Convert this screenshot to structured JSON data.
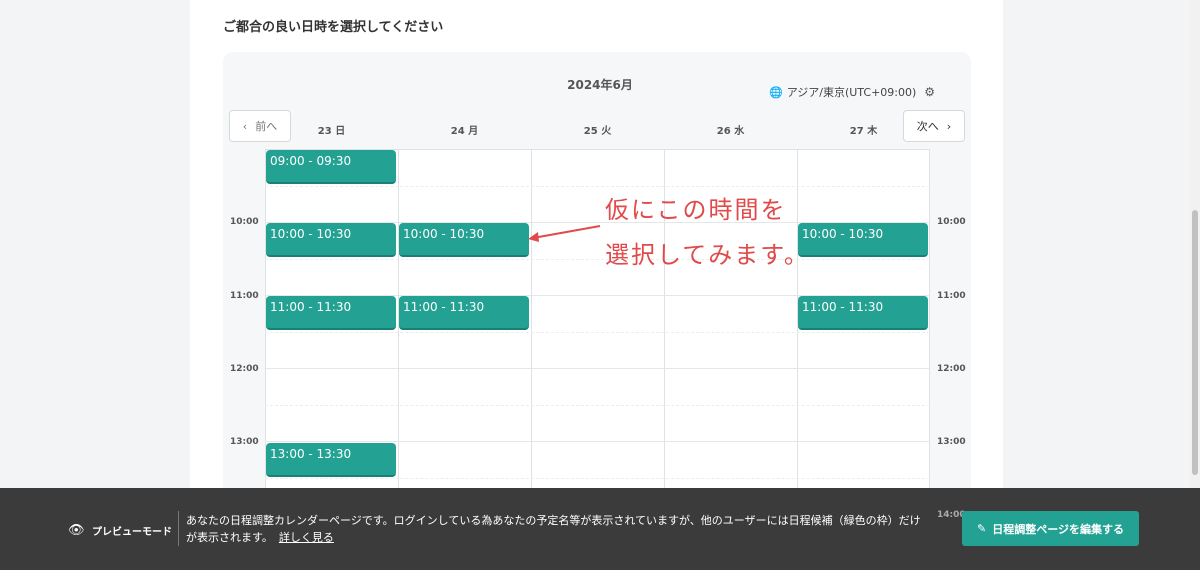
{
  "heading": "ご都合の良い日時を選択してください",
  "calendar": {
    "month": "2024年6月",
    "timezone": "アジア/東京(UTC+09:00)",
    "prev_label": "前へ",
    "next_label": "次へ",
    "days": [
      "23 日",
      "24 月",
      "25 火",
      "26 水",
      "27 木"
    ],
    "time_labels": [
      "10:00",
      "11:00",
      "12:00",
      "13:00",
      "14:00"
    ],
    "slots": [
      {
        "day": 0,
        "label": "09:00 - 09:30"
      },
      {
        "day": 0,
        "label": "10:00 - 10:30"
      },
      {
        "day": 0,
        "label": "11:00 - 11:30"
      },
      {
        "day": 0,
        "label": "13:00 - 13:30"
      },
      {
        "day": 1,
        "label": "10:00 - 10:30"
      },
      {
        "day": 1,
        "label": "11:00 - 11:30"
      },
      {
        "day": 4,
        "label": "10:00 - 10:30"
      },
      {
        "day": 4,
        "label": "11:00 - 11:30"
      }
    ]
  },
  "annotation": {
    "line1": "仮にこの時間を",
    "line2": "選択してみます。",
    "color": "#e04a4a"
  },
  "banner": {
    "mode_label": "プレビューモード",
    "message": "あなたの日程調整カレンダーページです。ログインしている為あなたの予定名等が表示されていますが、他のユーザーには日程候補（緑色の枠）だけが表示されます。",
    "link": "詳しく見る",
    "edit_button": "日程調整ページを編集する"
  },
  "colors": {
    "accent": "#23a294",
    "banner_bg": "#3b3b3b"
  }
}
